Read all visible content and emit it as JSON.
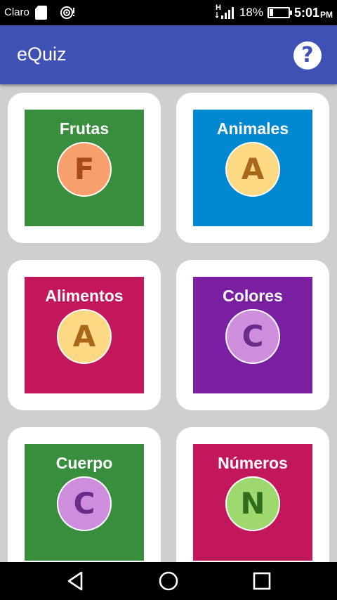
{
  "status_bar": {
    "carrier": "Claro",
    "signal_label": "H",
    "battery_percent": "18%",
    "battery_level": 0.18,
    "time": "5:01",
    "ampm": "PM"
  },
  "app_bar": {
    "title": "eQuiz",
    "help_label": "?"
  },
  "categories": [
    {
      "title": "Frutas",
      "letter": "F",
      "tile_color": "#388e3c",
      "circle_color": "#f7a06d",
      "letter_color": "#a84a18"
    },
    {
      "title": "Animales",
      "letter": "A",
      "tile_color": "#0288d1",
      "circle_color": "#fdd984",
      "letter_color": "#a8671a"
    },
    {
      "title": "Alimentos",
      "letter": "A",
      "tile_color": "#c2185b",
      "circle_color": "#fdd984",
      "letter_color": "#a8671a"
    },
    {
      "title": "Colores",
      "letter": "C",
      "tile_color": "#7b1fa2",
      "circle_color": "#cf8edd",
      "letter_color": "#6a2c8a"
    },
    {
      "title": "Cuerpo",
      "letter": "C",
      "tile_color": "#388e3c",
      "circle_color": "#cf8edd",
      "letter_color": "#6a2c8a"
    },
    {
      "title": "Números",
      "letter": "N",
      "tile_color": "#c2185b",
      "circle_color": "#9ed86e",
      "letter_color": "#2f6d1f"
    }
  ],
  "nav_bar": {
    "icons": [
      "back-icon",
      "home-icon",
      "recents-icon"
    ]
  }
}
